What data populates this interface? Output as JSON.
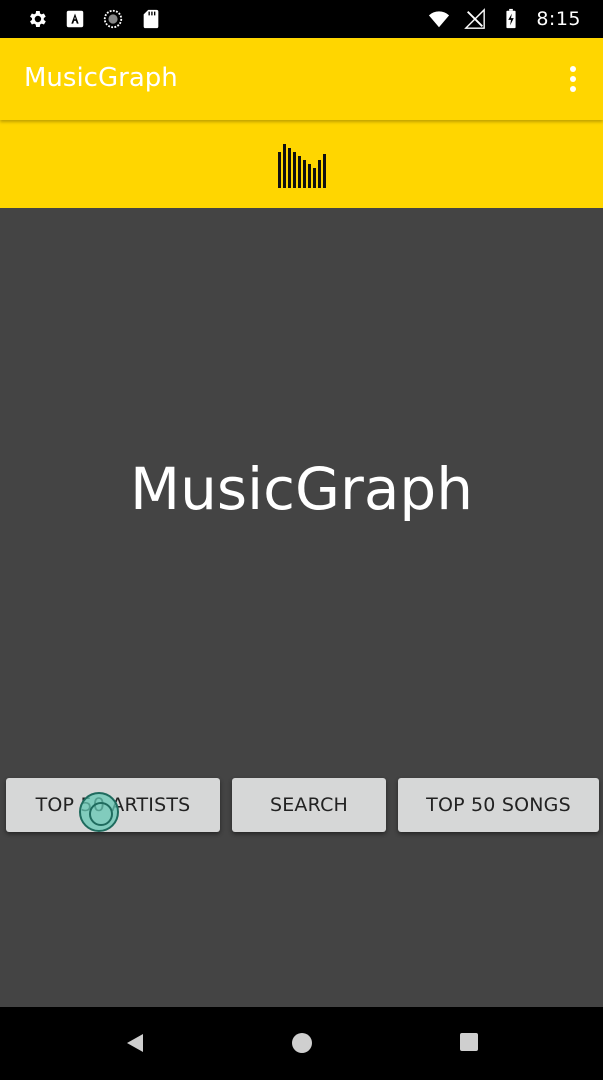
{
  "status_bar": {
    "time": "8:15",
    "left_icons": [
      "gear-icon",
      "font-a-icon",
      "sync-circle-icon",
      "sd-card-icon"
    ],
    "right_icons": [
      "wifi-icon",
      "signal-off-icon",
      "battery-charging-icon"
    ]
  },
  "app_bar": {
    "title": "MusicGraph",
    "overflow_icon": "more-vert-icon",
    "background": "#ffd600"
  },
  "logo": {
    "icon": "equalizer-bars-icon"
  },
  "main": {
    "title": "MusicGraph",
    "background": "#444444"
  },
  "buttons": {
    "top_artists": "TOP 50 ARTISTS",
    "search": "SEARCH",
    "top_songs": "TOP 50 SONGS"
  },
  "nav_bar": {
    "back_icon": "back-triangle-icon",
    "home_icon": "home-circle-icon",
    "recent_icon": "recents-square-icon"
  }
}
